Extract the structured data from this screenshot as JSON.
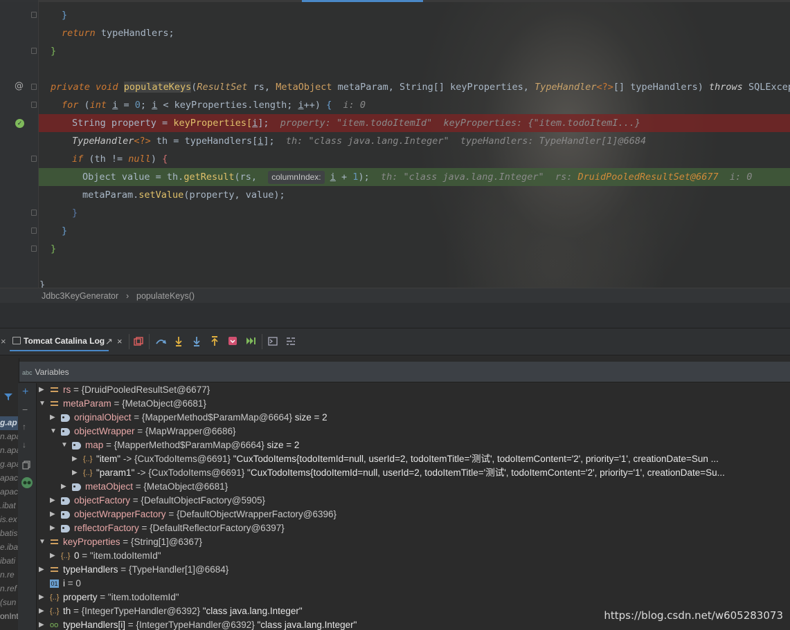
{
  "editor": {
    "gutter_marks": {
      "override": "@",
      "breakpoint_ok": "✓"
    },
    "lines": {
      "close1": "}",
      "return_kw": "return",
      "return_rest": " typeHandlers;",
      "close2": "}",
      "sig_private": "private",
      "sig_void": "void",
      "sig_method": "populateKeys",
      "sig_p1type": "ResultSet",
      "sig_p1": " rs, ",
      "sig_p2type": "MetaObject",
      "sig_p2": " metaParam, String[] keyProperties, ",
      "sig_p3type": "TypeHandler",
      "sig_p3gen": "<?>",
      "sig_p3rest": "[] typeHandlers) ",
      "sig_throws": "throws",
      "sig_exc": " SQLExcepti",
      "for_kw": "for",
      "for_int": "int",
      "for_i": "i",
      "for_init": " = ",
      "for_zero": "0",
      "for_cond": "; ",
      "for_i2": "i",
      "for_lt": " < keyProperties.length; ",
      "for_i3": "i",
      "for_inc": "++) ",
      "for_brace": "{",
      "for_hint": "i: 0",
      "prop_stmt_a": "String property = ",
      "prop_stmt_b": "keyProperties[",
      "prop_stmt_i": "i",
      "prop_stmt_c": "];",
      "prop_hint1": "property: \"item.todoItemId\"",
      "prop_hint2": "keyProperties: {\"item.todoItemI...}",
      "th_type": "TypeHandler",
      "th_gen": "<?>",
      "th_a": " th = typeHandlers[",
      "th_i": "i",
      "th_b": "];",
      "th_hint1": "th: \"class java.lang.Integer\"",
      "th_hint2": "typeHandlers: TypeHandler[1]@6684",
      "if_kw": "if",
      "if_a": " (th != ",
      "if_null": "null",
      "if_b": ") ",
      "if_brace": "{",
      "val_a": "Object value = th.",
      "val_fn": "getResult",
      "val_b": "(rs, ",
      "val_param_hint": "columnIndex:",
      "val_i": "i",
      "val_c": " + ",
      "val_one": "1",
      "val_d": ");",
      "val_hint1": "th: \"class java.lang.Integer\"",
      "val_hint2_label": "rs: ",
      "val_hint2_val": "DruidPooledResultSet@6677",
      "val_hint3": "i: 0",
      "set_a": "metaParam.",
      "set_fn": "setValue",
      "set_b": "(property, value);",
      "close3": "}",
      "close4": "}",
      "close5": "}",
      "close6": "}"
    }
  },
  "breadcrumb": {
    "class": "Jdbc3KeyGenerator",
    "sep": "›",
    "method": "populateKeys()"
  },
  "debug_toolbar": {
    "close_left": "×",
    "tab_label": "Tomcat Catalina Log",
    "tab_pin": "↗",
    "tab_close": "×"
  },
  "variables": {
    "header": "Variables",
    "header_icon": "abc",
    "rows": [
      {
        "name": "rs",
        "value": "= {DruidPooledResultSet@6677}"
      },
      {
        "name": "metaParam",
        "value": "= {MetaObject@6681}"
      },
      {
        "name": "originalObject",
        "value": "= {MapperMethod$ParamMap@6664}",
        "extra": "size = 2"
      },
      {
        "name": "objectWrapper",
        "value": "= {MapWrapper@6686}"
      },
      {
        "name": "map",
        "value": "= {MapperMethod$ParamMap@6664}",
        "extra": "size = 2"
      },
      {
        "name": "\"item\"",
        "value": "-> {CuxTodoItems@6691}",
        "extra": "\"CuxTodoItems{todoItemId=null, userId=2, todoItemTitle='测试', todoItemContent='2', priority='1', creationDate=Sun ..."
      },
      {
        "name": "\"param1\"",
        "value": "-> {CuxTodoItems@6691}",
        "extra": "\"CuxTodoItems{todoItemId=null, userId=2, todoItemTitle='测试', todoItemContent='2', priority='1', creationDate=Su..."
      },
      {
        "name": "metaObject",
        "value": "= {MetaObject@6681}"
      },
      {
        "name": "objectFactory",
        "value": "= {DefaultObjectFactory@5905}"
      },
      {
        "name": "objectWrapperFactory",
        "value": "= {DefaultObjectWrapperFactory@6396}"
      },
      {
        "name": "reflectorFactory",
        "value": "= {DefaultReflectorFactory@6397}"
      },
      {
        "name": "keyProperties",
        "value": "= {String[1]@6367}"
      },
      {
        "name": "0",
        "value": "= \"item.todoItemId\""
      },
      {
        "name": "typeHandlers",
        "value": "= {TypeHandler[1]@6684}"
      },
      {
        "name": "i",
        "value": "= 0"
      },
      {
        "name": "property",
        "value": "= \"item.todoItemId\""
      },
      {
        "name": "th",
        "value": "= {IntegerTypeHandler@6392}",
        "extra": "\"class java.lang.Integer\""
      },
      {
        "name": "typeHandlers[i]",
        "value": "= {IntegerTypeHandler@6392}",
        "extra": "\"class java.lang.Integer\""
      }
    ]
  },
  "frames": [
    "g.ap",
    "n.apa",
    "n.apa",
    "g.apa",
    "apac",
    "apac",
    ".ibat",
    "is.ex",
    "batis",
    "e.iba",
    "ibati",
    "n.re",
    "n.ref",
    "(sun",
    "onInt"
  ],
  "watermark": "https://blog.csdn.net/w605283073"
}
